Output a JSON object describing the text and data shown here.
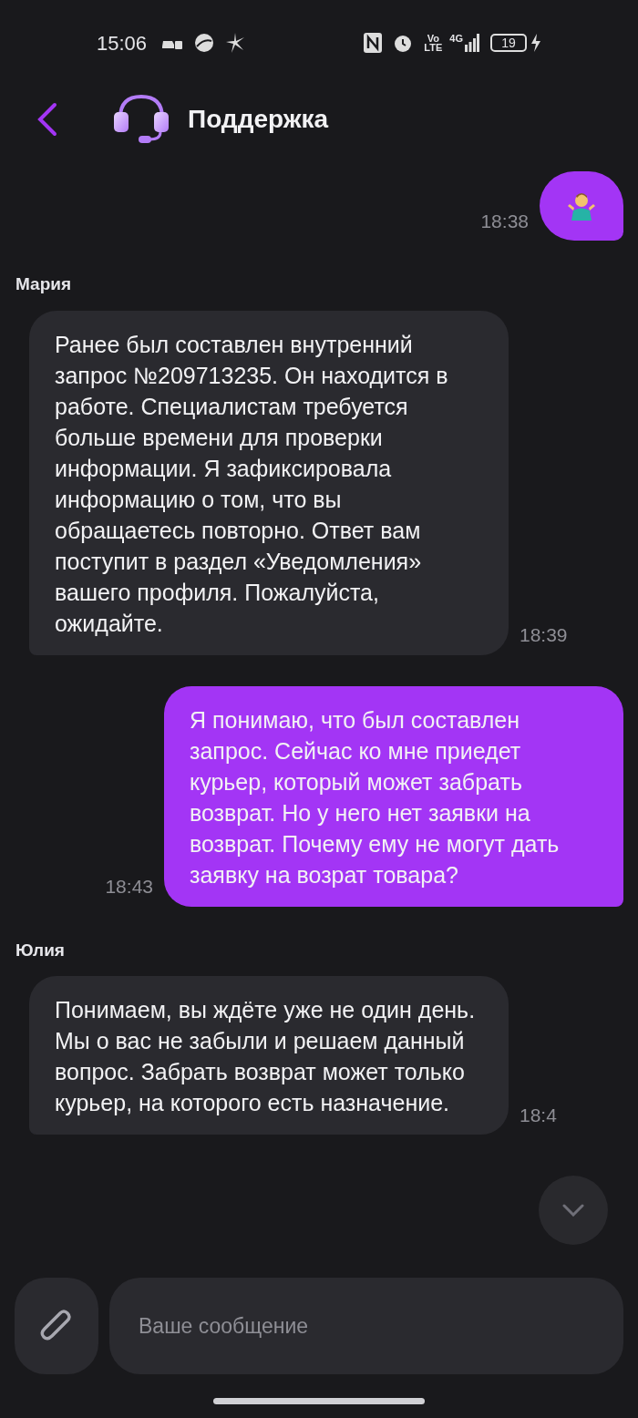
{
  "status_bar": {
    "time": "15:06",
    "volte_top": "Vo",
    "volte_bottom": "LTE",
    "network": "4G",
    "battery": "19"
  },
  "header": {
    "title": "Поддержка"
  },
  "messages": [
    {
      "kind": "sticker",
      "outgoing": true,
      "time": "18:38"
    },
    {
      "kind": "text",
      "outgoing": false,
      "author": "Мария",
      "text": "Ранее был составлен внутренний запрос №209713235. Он находится в работе. Специалистам требуется больше времени для проверки информации. Я зафиксировала информацию о том, что вы обращаетесь повторно. Ответ вам поступит в раздел «Уведомления» вашего профиля. Пожалуйста, ожидайте.",
      "time": "18:39"
    },
    {
      "kind": "text",
      "outgoing": true,
      "text": "Я понимаю, что был составлен запрос. Сейчас ко мне приедет курьер, который может забрать возврат. Но у него нет заявки на возврат. Почему ему не могут дать заявку на возрат товара?",
      "time": "18:43"
    },
    {
      "kind": "text",
      "outgoing": false,
      "author": "Юлия",
      "text": "Понимаем, вы ждёте уже не один день. Мы о вас не забыли и решаем данный вопрос. Забрать возврат может только курьер, на которого есть назначение.",
      "time": "18:4"
    }
  ],
  "composer": {
    "placeholder": "Ваше сообщение"
  }
}
